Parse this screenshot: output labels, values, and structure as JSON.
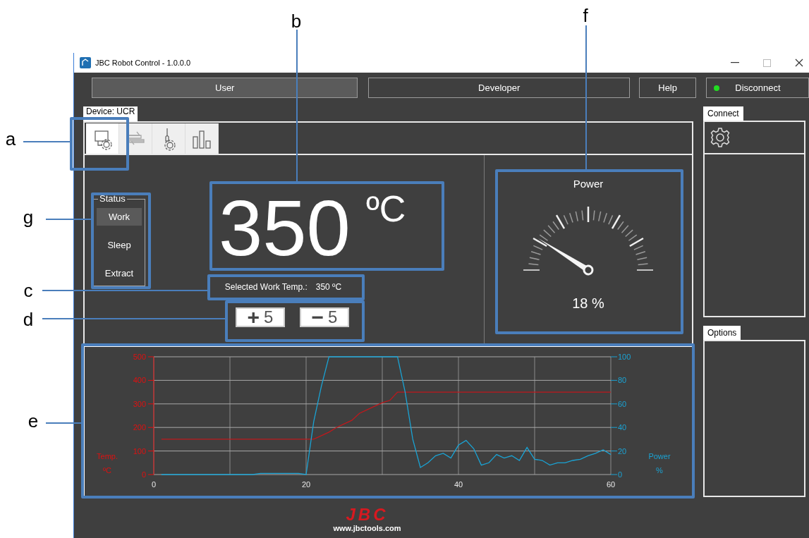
{
  "window": {
    "title": "JBC Robot Control - 1.0.0.0"
  },
  "top_buttons": [
    {
      "label": "User",
      "selected": true
    },
    {
      "label": "Developer",
      "selected": false
    },
    {
      "label": "Help",
      "selected": false
    }
  ],
  "connection": {
    "label": "Disconnect",
    "connected": true
  },
  "device": {
    "tab_label": "Device: UCR"
  },
  "icon_tabs": [
    {
      "kind": "station",
      "selected": true
    },
    {
      "kind": "transfer",
      "selected": false
    },
    {
      "kind": "tool",
      "selected": false
    },
    {
      "kind": "bars",
      "selected": false
    }
  ],
  "status": {
    "title": "Status",
    "items": [
      {
        "label": "Work",
        "selected": true
      },
      {
        "label": "Sleep",
        "selected": false
      },
      {
        "label": "Extract",
        "selected": false
      }
    ]
  },
  "temperature": {
    "value": "350",
    "unit": "ºC",
    "selected_label": "Selected Work Temp.:",
    "selected_value": "350 ºC"
  },
  "step_buttons": [
    {
      "sign": "+",
      "amount": "5"
    },
    {
      "sign": "−",
      "amount": "5"
    }
  ],
  "power": {
    "title": "Power",
    "level": 0.18,
    "reading": "18 %"
  },
  "chart": {
    "left_unit": "ºC",
    "right_unit": "%",
    "temperature_plot": {
      "chart_data": {
        "type": "line",
        "grid": true,
        "xlim": [
          0,
          60
        ],
        "ylim": [
          0,
          500
        ],
        "xticks": [
          0,
          20,
          40,
          60
        ],
        "yticks": [
          0,
          100,
          200,
          300,
          400,
          500
        ],
        "x": [
          1,
          2,
          3,
          4,
          5,
          6,
          7,
          8,
          9,
          10,
          11,
          12,
          13,
          14,
          15,
          16,
          17,
          18,
          19,
          20,
          21,
          22,
          23,
          24,
          25,
          26,
          27,
          28,
          29,
          30,
          31,
          32,
          33,
          34,
          35,
          36,
          37,
          38,
          39,
          40,
          41,
          42,
          43,
          44,
          45,
          46,
          47,
          48,
          49,
          50,
          51,
          52,
          53,
          54,
          55,
          56,
          57,
          58,
          59,
          60
        ],
        "series": [
          {
            "name": "Temp.",
            "color": "#c0181c",
            "values": [
              150,
              150,
              150,
              150,
              150,
              150,
              150,
              150,
              150,
              150,
              150,
              150,
              150,
              150,
              150,
              150,
              150,
              150,
              150,
              150,
              150,
              165,
              180,
              200,
              215,
              230,
              260,
              275,
              290,
              305,
              315,
              350,
              350,
              350,
              350,
              350,
              350,
              350,
              350,
              350,
              350,
              350,
              350,
              350,
              350,
              350,
              350,
              350,
              350,
              350,
              350,
              350,
              350,
              350,
              350,
              350,
              350,
              350,
              350,
              350
            ]
          }
        ]
      }
    },
    "power_plot": {
      "chart_data": {
        "type": "line",
        "xlim": [
          0,
          60
        ],
        "ylim": [
          0,
          100
        ],
        "yticks": [
          0,
          20,
          40,
          60,
          80,
          100
        ],
        "x": [
          1,
          2,
          3,
          4,
          5,
          6,
          7,
          8,
          9,
          10,
          11,
          12,
          13,
          14,
          15,
          16,
          17,
          18,
          19,
          20,
          21,
          22,
          23,
          24,
          25,
          26,
          27,
          28,
          29,
          30,
          31,
          32,
          33,
          34,
          35,
          36,
          37,
          38,
          39,
          40,
          41,
          42,
          43,
          44,
          45,
          46,
          47,
          48,
          49,
          50,
          51,
          52,
          53,
          54,
          55,
          56,
          57,
          58,
          59,
          60
        ],
        "series": [
          {
            "name": "Power",
            "color": "#1aa3d4",
            "values": [
              0,
              0,
              0,
              0,
              0,
              0,
              0,
              0,
              0,
              0,
              0,
              0,
              0,
              1,
              1,
              1,
              1,
              1,
              1,
              0,
              45,
              75,
              100,
              100,
              100,
              100,
              100,
              100,
              100,
              100,
              100,
              100,
              70,
              30,
              6,
              10,
              16,
              18,
              14,
              25,
              29,
              22,
              8,
              10,
              17,
              14,
              16,
              12,
              23,
              13,
              12,
              8,
              10,
              10,
              12,
              13,
              16,
              18,
              21,
              17
            ]
          }
        ]
      }
    }
  },
  "side": {
    "connect_label": "Connect",
    "options_label": "Options"
  },
  "footer": {
    "logo": "JBC",
    "url": "www.jbctools.com"
  },
  "callouts": [
    {
      "letter": "a"
    },
    {
      "letter": "b"
    },
    {
      "letter": "c"
    },
    {
      "letter": "d"
    },
    {
      "letter": "e"
    },
    {
      "letter": "f"
    },
    {
      "letter": "g"
    }
  ]
}
